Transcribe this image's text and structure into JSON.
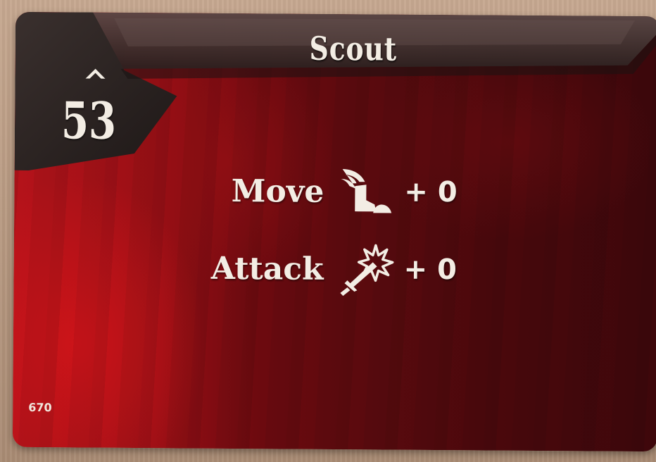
{
  "card": {
    "title": "Scout",
    "level": "53",
    "card_number": "670",
    "abilities": [
      {
        "label": "Move",
        "icon": "winged-boot-icon",
        "value": "+ 0"
      },
      {
        "label": "Attack",
        "icon": "sword-burst-icon",
        "value": "+ 0"
      }
    ]
  },
  "colors": {
    "card_red": "#9a0f15",
    "card_dark_red": "#3e070b",
    "header_band": "#4a3a38",
    "level_panel": "#2a2220",
    "text": "#f3ede4",
    "table": "#b89a82"
  }
}
